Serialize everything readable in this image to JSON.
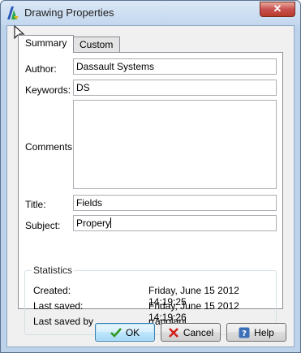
{
  "window": {
    "title": "Drawing Properties",
    "close_glyph": "✕"
  },
  "tabs": [
    {
      "label": "Summary",
      "active": true
    },
    {
      "label": "Custom",
      "active": false
    }
  ],
  "fields": {
    "author_label": "Author:",
    "author_value": "Dassault Systems",
    "keywords_label": "Keywords:",
    "keywords_value": "DS",
    "comments_label": "Comments:",
    "comments_value": "",
    "title_label": "Title:",
    "title_value": "Fields",
    "subject_label": "Subject:",
    "subject_value": "Propery"
  },
  "statistics": {
    "heading": "Statistics",
    "rows": [
      {
        "label": "Created:",
        "value": "Friday, June 15 2012 14:19:25"
      },
      {
        "label": "Last saved:",
        "value": "Friday, June 15 2012 14:19:26"
      },
      {
        "label": "Last saved by",
        "value": "rranglani"
      }
    ]
  },
  "buttons": {
    "ok": "OK",
    "cancel": "Cancel",
    "help": "Help"
  },
  "icons": {
    "app": "drawing-app-icon",
    "ok": "green-check-icon",
    "cancel": "red-x-icon",
    "help": "question-mark-icon",
    "cursor": "mouse-pointer-icon"
  },
  "colors": {
    "ok_check": "#2f9a1f",
    "cancel_x": "#d0201a",
    "help_blue": "#3a6fb8"
  }
}
